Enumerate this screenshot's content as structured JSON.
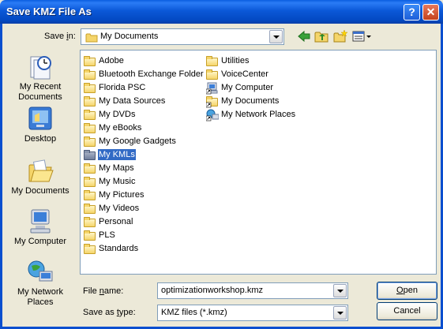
{
  "window": {
    "title": "Save KMZ File As",
    "help_glyph": "?",
    "close_glyph": "✕"
  },
  "save_in": {
    "label_pre": "Save ",
    "label_mnemonic": "i",
    "label_post": "n:",
    "value": "My Documents"
  },
  "toolbar": {
    "icons": [
      "back-arrow-icon",
      "up-one-level-icon",
      "new-folder-icon",
      "views-menu-icon"
    ]
  },
  "places": [
    {
      "label": "My Recent Documents",
      "icon": "recent-documents-icon"
    },
    {
      "label": "Desktop",
      "icon": "desktop-icon"
    },
    {
      "label": "My Documents",
      "icon": "my-documents-icon"
    },
    {
      "label": "My Computer",
      "icon": "my-computer-icon"
    },
    {
      "label": "My Network Places",
      "icon": "network-places-icon"
    }
  ],
  "files": {
    "column1": [
      "Adobe",
      "Bluetooth Exchange Folder",
      "Florida PSC",
      "My Data Sources",
      "My DVDs",
      "My eBooks",
      "My Google Gadgets",
      "My KMLs",
      "My Maps",
      "My Music",
      "My Pictures",
      "My Videos",
      "Personal",
      "PLS",
      "Standards"
    ],
    "column2": [
      "Utilities",
      "VoiceCenter",
      "My Computer",
      "My Documents",
      "My Network Places"
    ],
    "selected": "My KMLs"
  },
  "filename": {
    "label_pre": "File ",
    "label_mnemonic": "n",
    "label_post": "ame:",
    "value": "optimizationworkshop.kmz"
  },
  "filetype": {
    "label_pre": "Save as ",
    "label_mnemonic": "t",
    "label_post": "ype:",
    "value": "KMZ files (*.kmz)"
  },
  "buttons": {
    "open_mnemonic": "O",
    "open_rest": "pen",
    "cancel": "Cancel"
  }
}
